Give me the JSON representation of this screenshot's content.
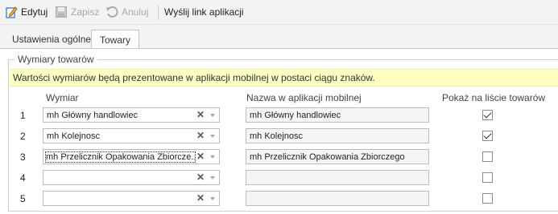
{
  "toolbar": {
    "edit_label": "Edytuj",
    "save_label": "Zapisz",
    "cancel_label": "Anuluj",
    "send_link_label": "Wyślij link aplikacji"
  },
  "tabs": [
    {
      "label": "Ustawienia ogólne",
      "active": false
    },
    {
      "label": "Towary",
      "active": true
    }
  ],
  "dimensions": {
    "group_title": "Wymiary towarów",
    "info_text": "Wartości wymiarów będą prezentowane w aplikacji mobilnej w postaci ciągu znaków.",
    "columns": {
      "dimension": "Wymiar",
      "mobile_name": "Nazwa w aplikacji mobilnej",
      "show_on_list": "Pokaż na liście towarów"
    },
    "rows": [
      {
        "num": "1",
        "dimension": "mh Główny handlowiec",
        "mobile_name": "mh Główny handlowiec",
        "show": true
      },
      {
        "num": "2",
        "dimension": "mh Kolejnosc",
        "mobile_name": "mh Kolejnosc",
        "show": true
      },
      {
        "num": "3",
        "dimension": "mh Przelicznik Opakowania Zbiorcze...",
        "mobile_name": "mh Przelicznik Opakowania Zbiorczego",
        "show": false
      },
      {
        "num": "4",
        "dimension": "",
        "mobile_name": "",
        "show": false
      },
      {
        "num": "5",
        "dimension": "",
        "mobile_name": "",
        "show": false
      }
    ]
  },
  "colors": {
    "info_background": "#ffffc4",
    "toolbar_background": "#f3f3f3",
    "edit_icon_accent": "#2f6fc6"
  }
}
